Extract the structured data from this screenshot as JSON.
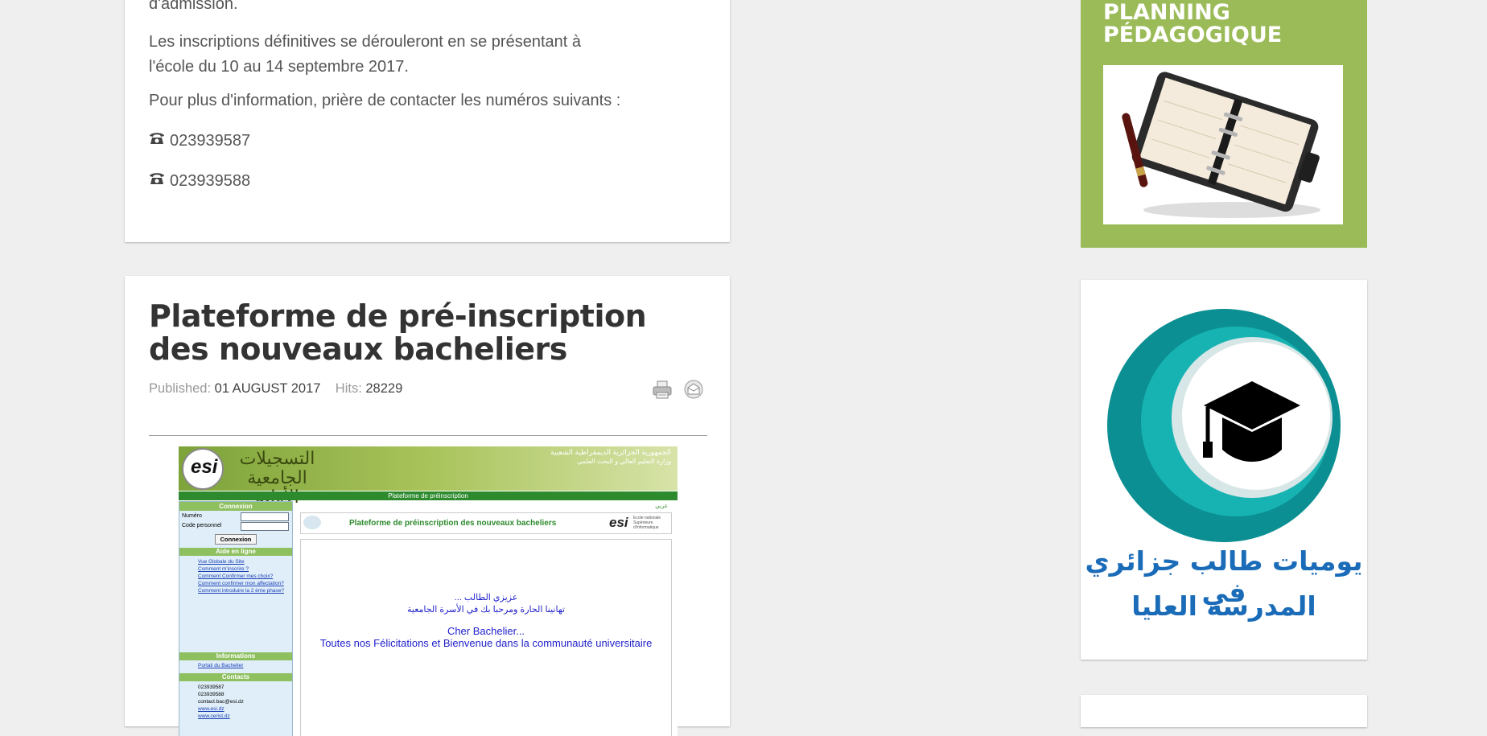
{
  "article1": {
    "partial_text": "d'admission.",
    "para_dates": "Les inscriptions définitives se dérouleront en se présentant à l'école du 10 au 14 septembre 2017.",
    "para_contact": "Pour plus d'information, prière de contacter les numéros suivants :",
    "phones": [
      "023939587",
      "023939588"
    ]
  },
  "article2": {
    "title": "Plateforme de pré-inscription des nouveaux bacheliers",
    "published_label": "Published:",
    "published_date": "01 AUGUST 2017",
    "hits_label": "Hits:",
    "hits_value": "28229"
  },
  "screenshot": {
    "header_ar_title": "التسجيلات الجامعية الأولية",
    "header_ar_right1": "الجمهورية الجزائرية الديمقراطية الشعبية",
    "header_ar_right2": "وزارة التعليم العالي و البحث العلمي",
    "logo": "esi",
    "banner": "Plateforme de préinscription",
    "sidebar": {
      "connexion_title": "Connexion",
      "numero_label": "Numéro",
      "code_label": "Code personnel",
      "connexion_button": "Connexion",
      "aide_title": "Aide en ligne",
      "aide_links": [
        "Vue Globale du Site",
        "Comment m'inscrire ?",
        "Comment Confirmer mes choix?",
        "Comment confirmer mon affectation?",
        "Comment introduire la 2 ème phase?"
      ],
      "info_title": "Informations",
      "info_links": [
        "Portail du Bachelier"
      ],
      "contacts_title": "Contacts",
      "contacts": [
        "023939587",
        "023939588",
        "contact.bac@esi.dz",
        "www.esi.dz",
        "www.cerist.dz"
      ]
    },
    "lang_link": "عربي",
    "content_header": "Plateforme de préinscription des nouveaux bacheliers",
    "esi_side_lines": [
      "Ecole nationale",
      "Supérieure",
      "d'Informatique"
    ],
    "welcome_ar1": "عزيزي الطالب ...",
    "welcome_ar2": "تهانينا الحارة ومرحبا بك في الأسرة الجامعية",
    "welcome_fr1": "Cher Bachelier...",
    "welcome_fr2": "Toutes nos Félicitations et Bienvenue dans la communauté universitaire"
  },
  "sidebar_right": {
    "planning_title_line1": "PLANNING",
    "planning_title_line2": "PÉDAGOGIQUE",
    "student_ar_line1": "يوميات طالب جزائري في",
    "student_ar_line2": "المدرسة العليا"
  },
  "colors": {
    "background": "#efefef",
    "planning_green": "#9bbb59",
    "arabic_blue": "#1a6bb8",
    "teal": "#0d9a9e",
    "esi_green": "#6f9b2f"
  }
}
